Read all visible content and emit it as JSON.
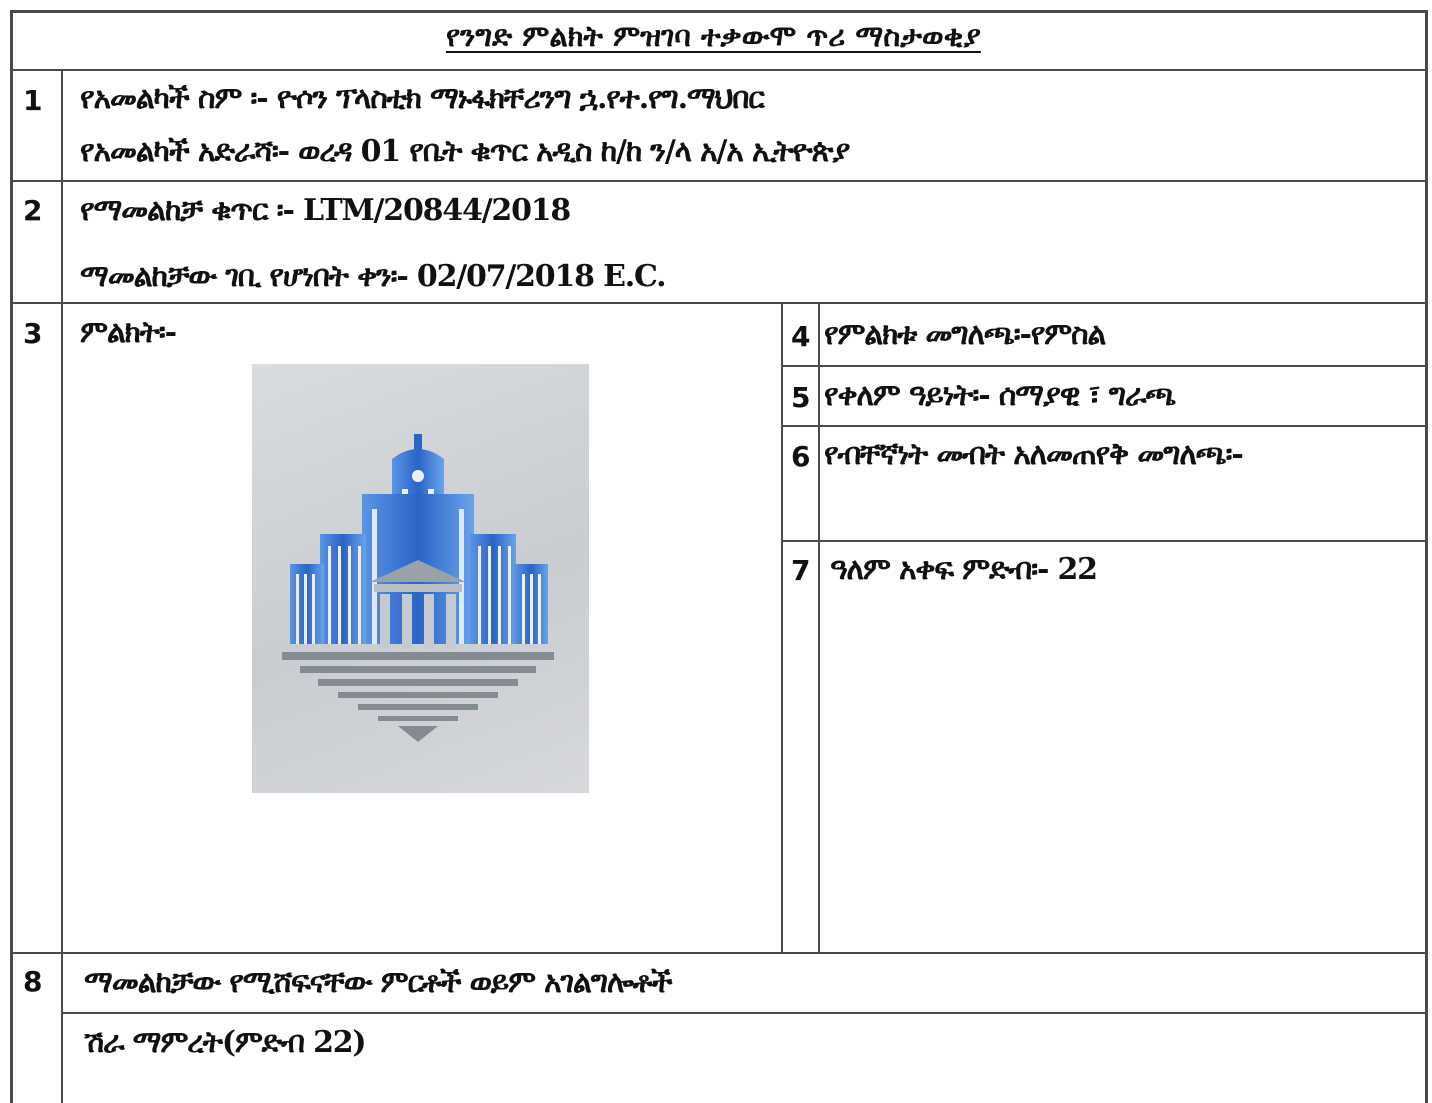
{
  "title": "የንግድ ምልክት ምዝገባ ተቃውሞ ጥሪ ማስታወቂያ",
  "rows": [
    {
      "num": "1",
      "lines": [
        "የአመልካች ስም ፡- ዮሶን ፕላስቲክ ማኑፋክቸሪንግ ኋ.የተ.የግ.ማህበር",
        "የአመልካች አድራሻ፡- ወረዳ 01 የቤት ቁጥር አዲስ ከ/ከ ን/ላ  አ/አ ኢትዮጵያ"
      ]
    },
    {
      "num": "2",
      "lines": [
        "የማመልከቻ ቁጥር ፡- LTM/20844/2018",
        "ማመልከቻው ገቢ የሆነበት ቀን፡- 02/07/2018 E.C."
      ]
    },
    {
      "num": "3",
      "lines": [
        "ምልክት፡-"
      ]
    },
    {
      "num": "4",
      "lines": [
        "የምልክቱ መግለጫ፡-የምስል"
      ]
    },
    {
      "num": "5",
      "lines": [
        "የቀለም ዓይነት፡- ሰማያዊ ፣ ግራጫ"
      ]
    },
    {
      "num": "6",
      "lines": [
        "የብቸኛነት መብት አለመጠየቅ መግለጫ፡-"
      ]
    },
    {
      "num": "7",
      "lines": [
        "ዓለም አቀፍ ምድብ፡- 22"
      ]
    },
    {
      "num": "8",
      "lines": [
        "ማመልከቻው የሚሸፍናቸው ምርቶች ወይም አገልግሎቶች",
        "ሽራ ማምረት(ምድብ 22)"
      ]
    }
  ],
  "colors": {
    "logo_blue": "#2f6fd0",
    "logo_gray": "#8e949b",
    "line": "#4a4a4a"
  }
}
